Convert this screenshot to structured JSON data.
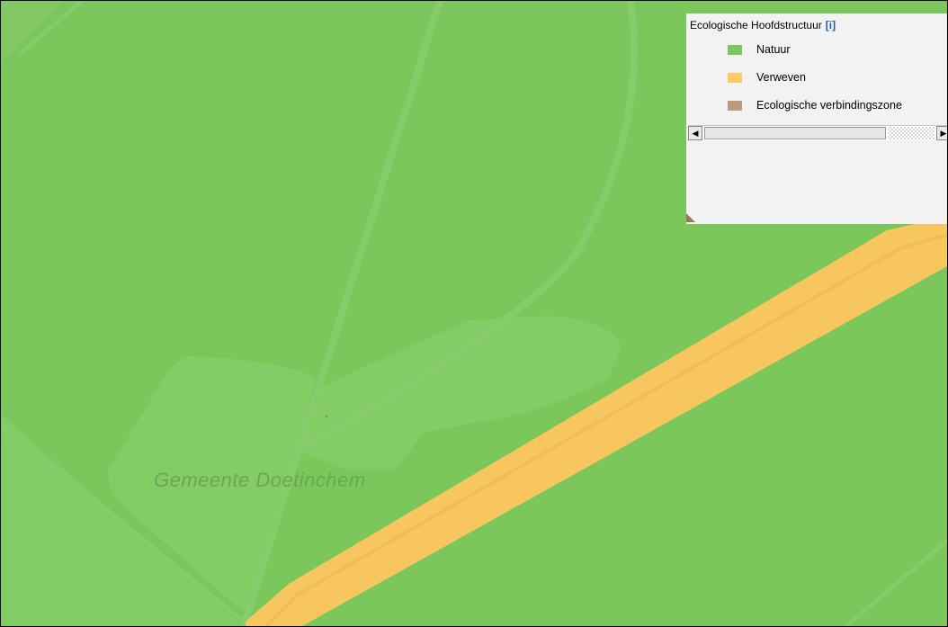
{
  "map": {
    "place_label": "Gemeente  Doetinchem"
  },
  "legend": {
    "title": "Ecologische Hoofdstructuur",
    "info_link": "[i]",
    "items": [
      {
        "label": "Natuur",
        "color": "#7cc75c"
      },
      {
        "label": "Verweven",
        "color": "#ffc966"
      },
      {
        "label": "Ecologische verbindingszone",
        "color": "#b79c7f"
      }
    ]
  },
  "scrollbar": {
    "left_arrow": "◀",
    "right_arrow": "▶"
  }
}
